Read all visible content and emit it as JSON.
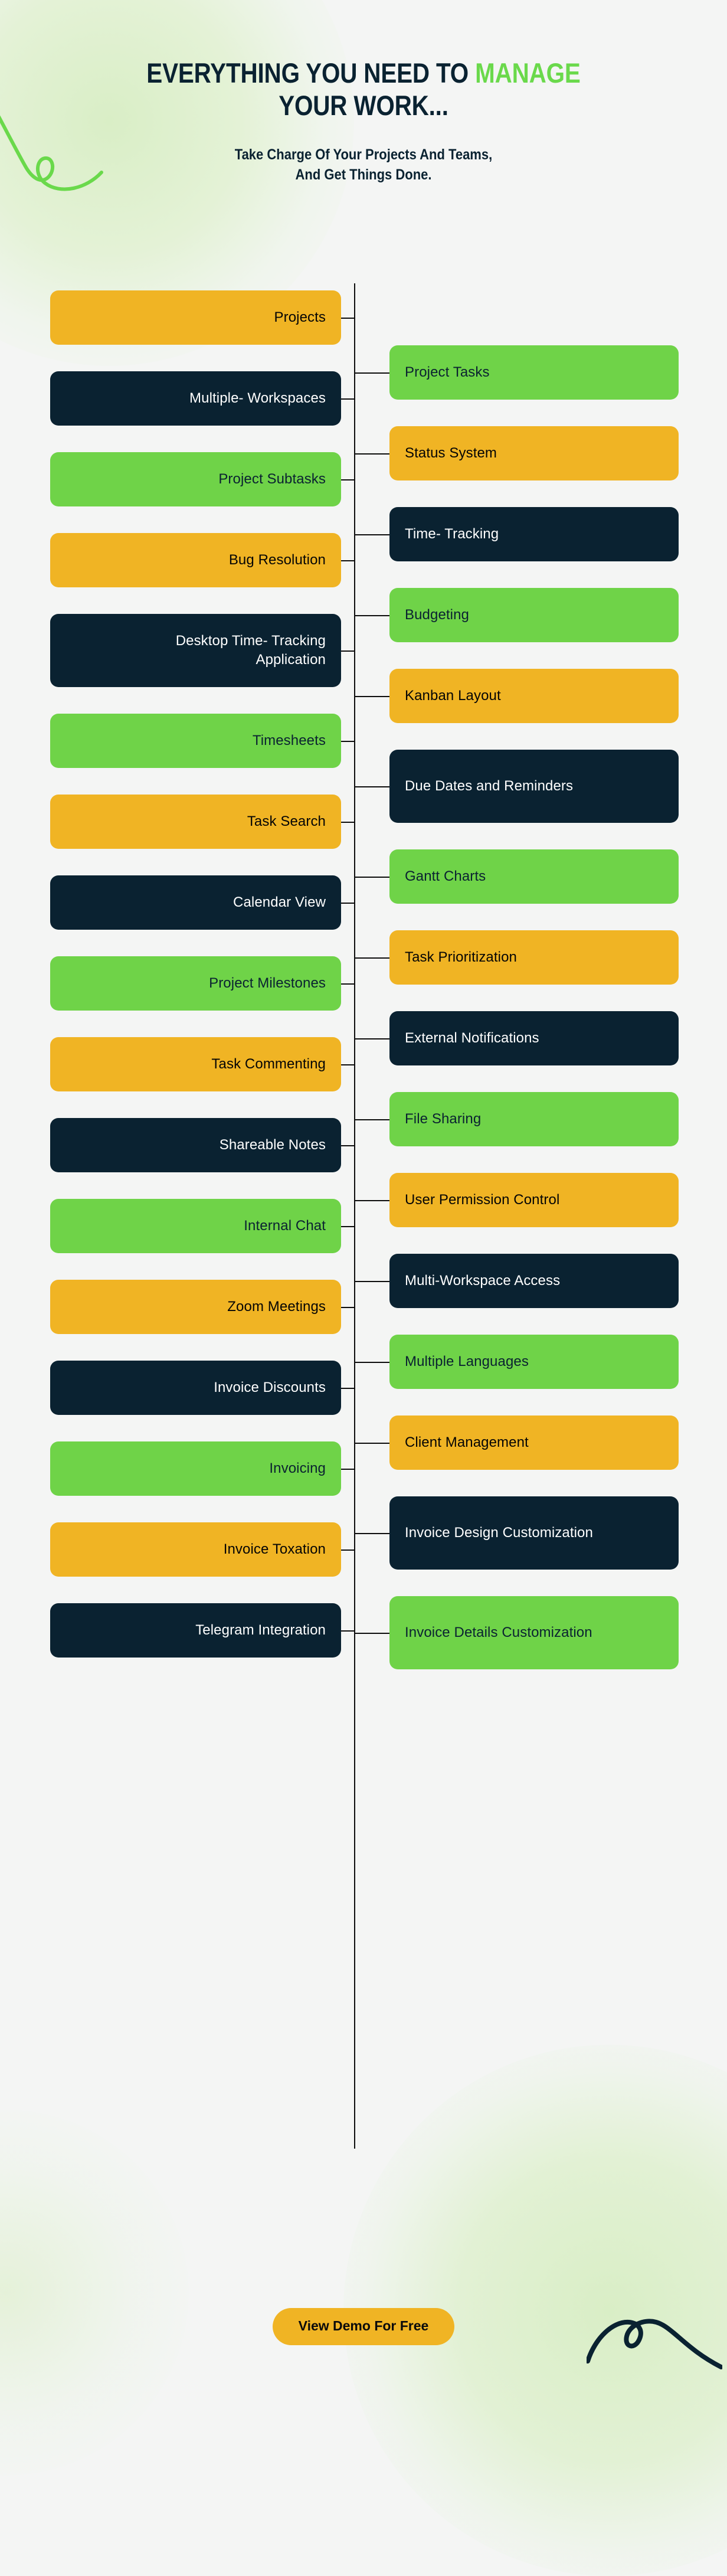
{
  "header": {
    "title_part1": "EVERYTHING YOU NEED TO ",
    "title_highlight": "MANAGE",
    "title_part2": "YOUR WORK...",
    "subtitle_line1": "Take Charge Of Your Projects And Teams,",
    "subtitle_line2": "And Get Things Done."
  },
  "colors": {
    "background": "#f4f5f4",
    "yellow": "#f0b424",
    "navy": "#0a2231",
    "green": "#6fd348",
    "accent_green_text": "#6ad94b",
    "rail": "#0d0d0d"
  },
  "timeline": {
    "left_column": [
      {
        "label": "Projects",
        "color": "yellow",
        "lines": 1
      },
      {
        "label": "Multiple- Workspaces",
        "color": "navy",
        "lines": 1
      },
      {
        "label": "Project Subtasks",
        "color": "green",
        "lines": 1
      },
      {
        "label": "Bug Resolution",
        "color": "yellow",
        "lines": 1
      },
      {
        "label": "Desktop Time- Tracking Application",
        "color": "navy",
        "lines": 2
      },
      {
        "label": "Timesheets",
        "color": "green",
        "lines": 1
      },
      {
        "label": "Task Search",
        "color": "yellow",
        "lines": 1
      },
      {
        "label": "Calendar View",
        "color": "navy",
        "lines": 1
      },
      {
        "label": "Project Milestones",
        "color": "green",
        "lines": 1
      },
      {
        "label": "Task Commenting",
        "color": "yellow",
        "lines": 1
      },
      {
        "label": "Shareable Notes",
        "color": "navy",
        "lines": 1
      },
      {
        "label": "Internal Chat",
        "color": "green",
        "lines": 1
      },
      {
        "label": "Zoom Meetings",
        "color": "yellow",
        "lines": 1
      },
      {
        "label": "Invoice Discounts",
        "color": "navy",
        "lines": 1
      },
      {
        "label": "Invoicing",
        "color": "green",
        "lines": 1
      },
      {
        "label": "Invoice Toxation",
        "color": "yellow",
        "lines": 1
      },
      {
        "label": "Telegram Integration",
        "color": "navy",
        "lines": 1
      }
    ],
    "right_column": [
      {
        "label": "Project Tasks",
        "color": "green",
        "lines": 1
      },
      {
        "label": "Status System",
        "color": "yellow",
        "lines": 1
      },
      {
        "label": "Time- Tracking",
        "color": "navy",
        "lines": 1
      },
      {
        "label": "Budgeting",
        "color": "green",
        "lines": 1
      },
      {
        "label": "Kanban Layout",
        "color": "yellow",
        "lines": 1
      },
      {
        "label": "Due Dates and Reminders",
        "color": "navy",
        "lines": 2
      },
      {
        "label": "Gantt Charts",
        "color": "green",
        "lines": 1
      },
      {
        "label": "Task Prioritization",
        "color": "yellow",
        "lines": 1
      },
      {
        "label": "External Notifications",
        "color": "navy",
        "lines": 1
      },
      {
        "label": "File Sharing",
        "color": "green",
        "lines": 1
      },
      {
        "label": "User Permission Control",
        "color": "yellow",
        "lines": 1
      },
      {
        "label": "Multi-Workspace Access",
        "color": "navy",
        "lines": 1
      },
      {
        "label": "Multiple Languages",
        "color": "green",
        "lines": 1
      },
      {
        "label": "Client Management",
        "color": "yellow",
        "lines": 1
      },
      {
        "label": "Invoice Design Customization",
        "color": "navy",
        "lines": 2
      },
      {
        "label": "Invoice Details Customization",
        "color": "green",
        "lines": 2
      }
    ]
  },
  "cta": {
    "button_label": "View Demo For Free"
  }
}
